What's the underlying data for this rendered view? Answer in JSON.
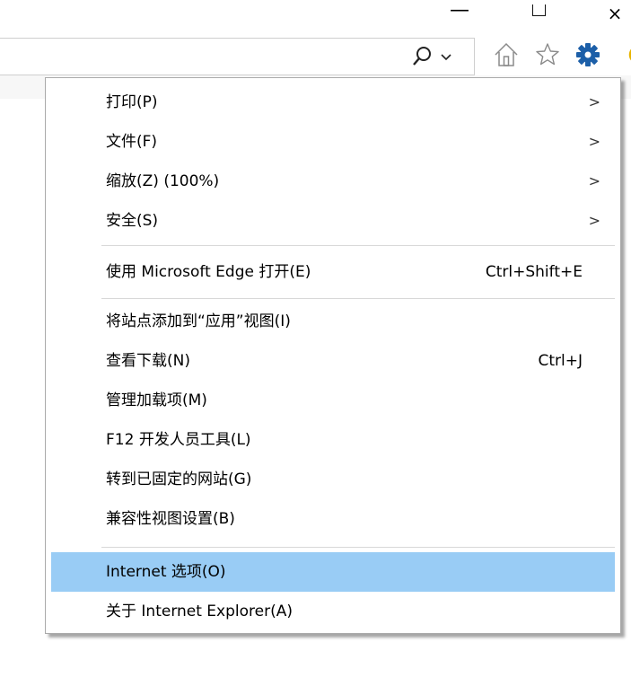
{
  "window": {
    "minimize_glyph": "—",
    "close_glyph": "×"
  },
  "toolbar": {
    "icons": [
      "search-icon",
      "search-dropdown-icon",
      "home-icon",
      "favorites-star-icon",
      "gear-icon"
    ]
  },
  "menu": {
    "group1": [
      {
        "label": "打印(P)",
        "submenu": ">"
      },
      {
        "label": "文件(F)",
        "submenu": ">"
      },
      {
        "label": "缩放(Z) (100%)",
        "submenu": ">"
      },
      {
        "label": "安全(S)",
        "submenu": ">"
      }
    ],
    "edge": {
      "label": "使用 Microsoft Edge 打开(E)",
      "shortcut": "Ctrl+Shift+E"
    },
    "group3": [
      {
        "label": "将站点添加到“应用”视图(I)",
        "shortcut": ""
      },
      {
        "label": "查看下载(N)",
        "shortcut": "Ctrl+J"
      },
      {
        "label": "管理加载项(M)",
        "shortcut": ""
      },
      {
        "label": "F12 开发人员工具(L)",
        "shortcut": ""
      },
      {
        "label": "转到已固定的网站(G)",
        "shortcut": ""
      },
      {
        "label": "兼容性视图设置(B)",
        "shortcut": ""
      }
    ],
    "group4": [
      {
        "label": "Internet 选项(O)",
        "highlighted": true
      },
      {
        "label": "关于 Internet Explorer(A)",
        "highlighted": false
      }
    ]
  },
  "colors": {
    "highlight": "#99ccf5",
    "gear": "#1c5fa8",
    "separator": "#d8d8d8"
  }
}
